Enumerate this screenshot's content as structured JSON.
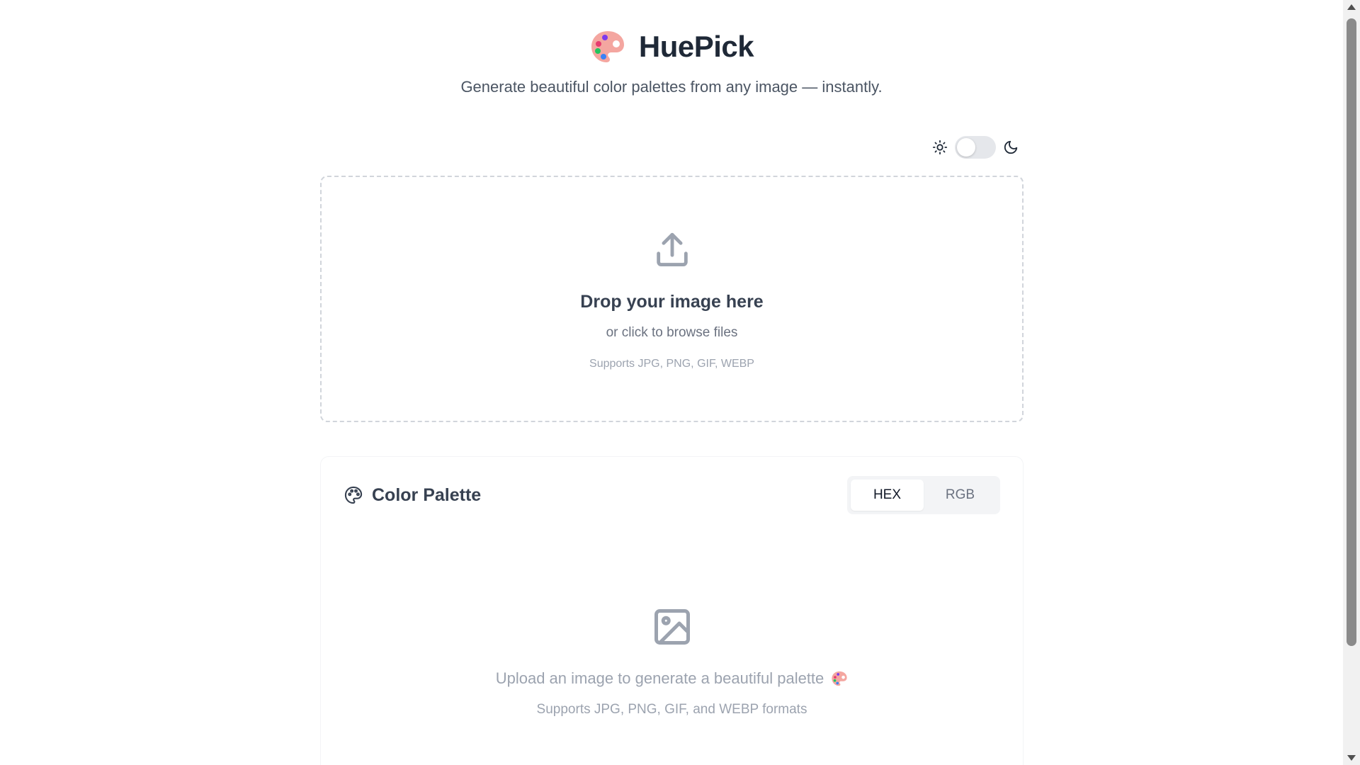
{
  "app": {
    "name": "HuePick",
    "tagline": "Generate beautiful color palettes from any image — instantly."
  },
  "theme_toggle": {
    "mode": "light",
    "icons": [
      "sun-icon",
      "moon-icon"
    ]
  },
  "dropzone": {
    "title": "Drop your image here",
    "subtitle": "or click to browse files",
    "formats": "Supports JPG, PNG, GIF, WEBP",
    "icon": "upload-icon"
  },
  "palette": {
    "title": "Color Palette",
    "icon": "palette-icon",
    "tabs": [
      {
        "label": "HEX",
        "active": true
      },
      {
        "label": "RGB",
        "active": false
      }
    ],
    "empty_state": {
      "icon": "image-icon",
      "message": "Upload an image to generate a beautiful palette",
      "formats": "Supports JPG, PNG, GIF, and WEBP formats"
    }
  },
  "colors": {
    "text_primary": "#1f2937",
    "text_muted": "#9ca3af",
    "toggle_track": "#e5e7eb",
    "tab_bg": "#f3f4f6",
    "dashed_border": "#d1d5db"
  }
}
